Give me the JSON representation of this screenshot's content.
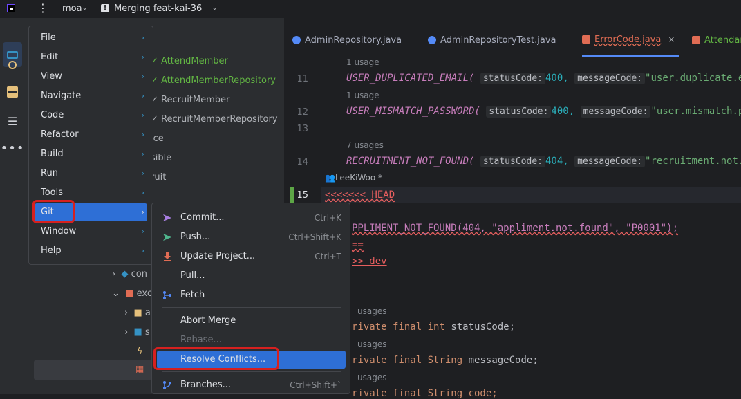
{
  "titlebar": {
    "project": "moa",
    "branch": "Merging feat-kai-36"
  },
  "toolstrip": {
    "icons": [
      "project-icon",
      "commit-icon",
      "structure-icon",
      "pull-requests-icon",
      "more-icon"
    ],
    "more_label": "•••"
  },
  "tree": {
    "items": [
      {
        "label": "AttendMember",
        "color": "green"
      },
      {
        "label": "AttendMemberRepository",
        "color": "green"
      },
      {
        "label": "RecruitMember",
        "color": "gray"
      },
      {
        "label": "RecruitMemberRepository",
        "color": "gray"
      },
      {
        "label": "ice",
        "color": "gray"
      },
      {
        "label": "sible",
        "color": "gray"
      },
      {
        "label": "ruit",
        "color": "gray"
      }
    ],
    "folders": [
      "con",
      "exc",
      "a",
      "s"
    ]
  },
  "tabs": [
    {
      "label": "AdminRepository.java",
      "active": false
    },
    {
      "label": "AdminRepositoryTest.java",
      "active": false
    },
    {
      "label": "ErrorCode.java",
      "active": true,
      "close": "×"
    },
    {
      "label": "Attendan",
      "active": false
    }
  ],
  "editor": {
    "line_numbers": [
      "11",
      "12",
      "13",
      "14",
      "15"
    ],
    "usage_1": "1 usage",
    "usage_7": "7 usages",
    "usages": "usages",
    "l11_name": "USER_DUPLICATED_EMAIL(",
    "l12_name": "USER_MISMATCH_PASSWORD(",
    "l14_name": "RECRUITMENT_NOT_FOUND(",
    "hint_status": "statusCode:",
    "hint_message": "messageCode:",
    "v400": "400,",
    "v404": "404,",
    "s11": "\"user.duplicate.em",
    "s12": "\"user.mismatch.pa",
    "s14": "\"recruitment.not.f",
    "author": "LeeKiWoo *",
    "head": "<<<<<<< HEAD",
    "appliment": "PPLIMENT_NOT_FOUND(404, \"appliment.not.found\", \"P0001\");",
    "equals": "==",
    "dev": ">> dev",
    "f1_pre": "rivate final",
    "f1_type": "int",
    "f1_name": "statusCode;",
    "f2_pre": "rivate final",
    "f2_type": "String",
    "f2_name": "messageCode;",
    "f3_pre": "rivate final String code;"
  },
  "main_menu": {
    "items": [
      {
        "label": "File",
        "arrow": "›"
      },
      {
        "label": "Edit",
        "arrow": "›"
      },
      {
        "label": "View",
        "arrow": "›"
      },
      {
        "label": "Navigate",
        "arrow": "›"
      },
      {
        "label": "Code",
        "arrow": "›"
      },
      {
        "label": "Refactor",
        "arrow": "›"
      },
      {
        "label": "Build",
        "arrow": "›"
      },
      {
        "label": "Run",
        "arrow": "›"
      },
      {
        "label": "Tools",
        "arrow": "›"
      },
      {
        "label": "Git",
        "arrow": "›",
        "selected": true
      },
      {
        "label": "Window",
        "arrow": "›"
      },
      {
        "label": "Help",
        "arrow": "›"
      }
    ]
  },
  "git_menu": {
    "commit": {
      "label": "Commit...",
      "shortcut": "Ctrl+K"
    },
    "push": {
      "label": "Push...",
      "shortcut": "Ctrl+Shift+K"
    },
    "update": {
      "label": "Update Project...",
      "shortcut": "Ctrl+T"
    },
    "pull": {
      "label": "Pull..."
    },
    "fetch": {
      "label": "Fetch"
    },
    "abort": {
      "label": "Abort Merge"
    },
    "rebase": {
      "label": "Rebase..."
    },
    "resolve": {
      "label": "Resolve Conflicts..."
    },
    "branches": {
      "label": "Branches...",
      "shortcut": "Ctrl+Shift+`"
    }
  },
  "colors": {
    "accent": "#2e6fd6",
    "annotation": "#d6201f",
    "conflict": "#e55e5e"
  }
}
